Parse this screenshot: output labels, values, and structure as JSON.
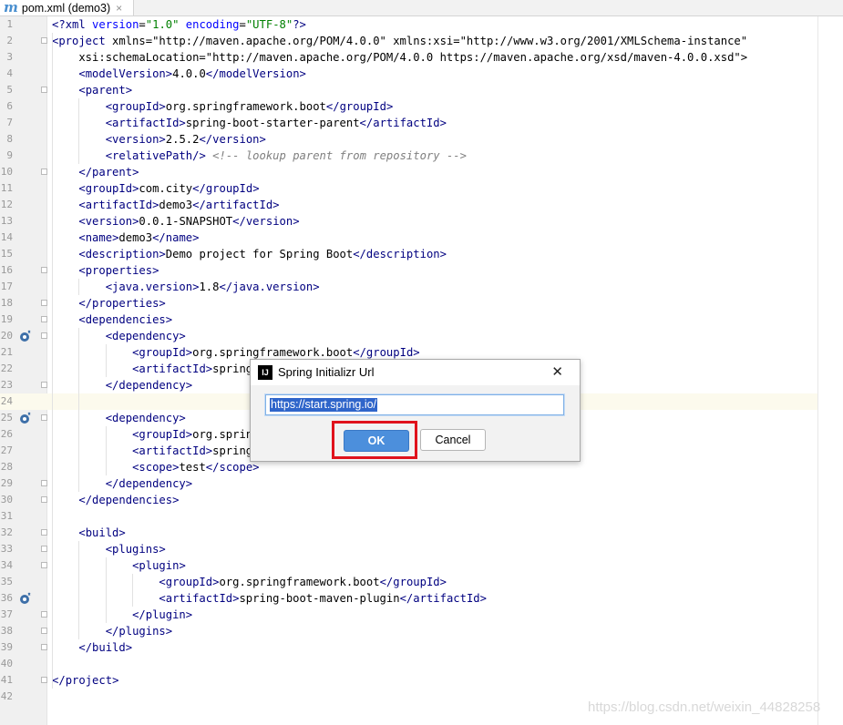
{
  "tab": {
    "icon": "m",
    "title": "pom.xml (demo3)",
    "close": "×"
  },
  "editor": {
    "current_line": 24,
    "gutter_marks": [
      20,
      25,
      36
    ],
    "fold_lines": [
      2,
      5,
      10,
      16,
      18,
      19,
      20,
      23,
      25,
      29,
      30,
      32,
      33,
      34,
      37,
      38,
      39,
      41
    ],
    "lines": [
      {
        "n": "1",
        "code": "<?xml version=\"1.0\" encoding=\"UTF-8\"?>"
      },
      {
        "n": "2",
        "code": "<project xmlns=\"http://maven.apache.org/POM/4.0.0\" xmlns:xsi=\"http://www.w3.org/2001/XMLSchema-instance\""
      },
      {
        "n": "3",
        "code": "    xsi:schemaLocation=\"http://maven.apache.org/POM/4.0.0 https://maven.apache.org/xsd/maven-4.0.0.xsd\">"
      },
      {
        "n": "4",
        "code": "    <modelVersion>4.0.0</modelVersion>"
      },
      {
        "n": "5",
        "code": "    <parent>"
      },
      {
        "n": "6",
        "code": "        <groupId>org.springframework.boot</groupId>"
      },
      {
        "n": "7",
        "code": "        <artifactId>spring-boot-starter-parent</artifactId>"
      },
      {
        "n": "8",
        "code": "        <version>2.5.2</version>"
      },
      {
        "n": "9",
        "code": "        <relativePath/> <!-- lookup parent from repository -->"
      },
      {
        "n": "10",
        "code": "    </parent>"
      },
      {
        "n": "11",
        "code": "    <groupId>com.city</groupId>"
      },
      {
        "n": "12",
        "code": "    <artifactId>demo3</artifactId>"
      },
      {
        "n": "13",
        "code": "    <version>0.0.1-SNAPSHOT</version>"
      },
      {
        "n": "14",
        "code": "    <name>demo3</name>"
      },
      {
        "n": "15",
        "code": "    <description>Demo project for Spring Boot</description>"
      },
      {
        "n": "16",
        "code": "    <properties>"
      },
      {
        "n": "17",
        "code": "        <java.version>1.8</java.version>"
      },
      {
        "n": "18",
        "code": "    </properties>"
      },
      {
        "n": "19",
        "code": "    <dependencies>"
      },
      {
        "n": "20",
        "code": "        <dependency>"
      },
      {
        "n": "21",
        "code": "            <groupId>org.springframework.boot</groupId>"
      },
      {
        "n": "22",
        "code": "            <artifactId>spring-"
      },
      {
        "n": "23",
        "code": "        </dependency>"
      },
      {
        "n": "24",
        "code": ""
      },
      {
        "n": "25",
        "code": "        <dependency>"
      },
      {
        "n": "26",
        "code": "            <groupId>org.spring"
      },
      {
        "n": "27",
        "code": "            <artifactId>spring-"
      },
      {
        "n": "28",
        "code": "            <scope>test</scope>"
      },
      {
        "n": "29",
        "code": "        </dependency>"
      },
      {
        "n": "30",
        "code": "    </dependencies>"
      },
      {
        "n": "31",
        "code": ""
      },
      {
        "n": "32",
        "code": "    <build>"
      },
      {
        "n": "33",
        "code": "        <plugins>"
      },
      {
        "n": "34",
        "code": "            <plugin>"
      },
      {
        "n": "35",
        "code": "                <groupId>org.springframework.boot</groupId>"
      },
      {
        "n": "36",
        "code": "                <artifactId>spring-boot-maven-plugin</artifactId>"
      },
      {
        "n": "37",
        "code": "            </plugin>"
      },
      {
        "n": "38",
        "code": "        </plugins>"
      },
      {
        "n": "39",
        "code": "    </build>"
      },
      {
        "n": "40",
        "code": ""
      },
      {
        "n": "41",
        "code": "</project>"
      },
      {
        "n": "42",
        "code": ""
      }
    ]
  },
  "dialog": {
    "icon": "IJ",
    "title": "Spring Initializr Url",
    "close": "✕",
    "url_value": "https://start.spring.io/",
    "ok_label": "OK",
    "cancel_label": "Cancel"
  },
  "watermark": "https://blog.csdn.net/weixin_44828258",
  "colors": {
    "tag": "#000080",
    "attr_name": "#0000ff",
    "attr_value": "#008000",
    "namespace": "#660e7a",
    "comment": "#808080",
    "highlight_box": "#e0121c",
    "ok_button": "#4c8fdc"
  }
}
